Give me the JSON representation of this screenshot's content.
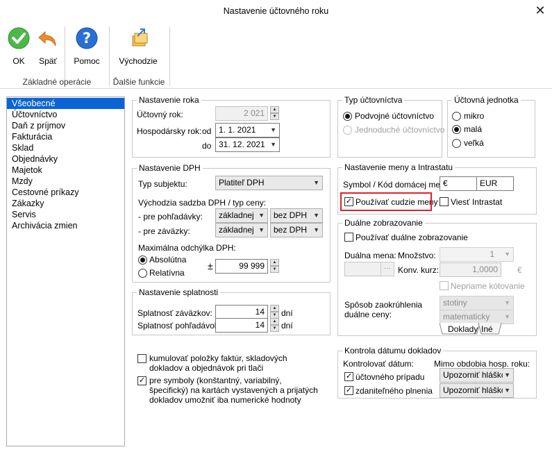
{
  "window": {
    "title": "Nastavenie účtovného roku",
    "close": "✕"
  },
  "ribbon": {
    "ok": "OK",
    "back": "Späť",
    "help": "Pomoc",
    "defaults": "Východzie",
    "group_basic": "Základné operácie",
    "group_more": "Ďalšie funkcie"
  },
  "nav": {
    "items": [
      "Všeobecné",
      "Účtovníctvo",
      "Daň z príjmov",
      "Fakturácia",
      "Sklad",
      "Objednávky",
      "Majetok",
      "Mzdy",
      "Cestovné príkazy",
      "Zákazky",
      "Servis",
      "Archivácia zmien"
    ],
    "selected": 0
  },
  "year": {
    "legend": "Nastavenie roka",
    "accounting_year_label": "Účtovný rok:",
    "accounting_year": "2 021",
    "fiscal_year_label": "Hospodársky rok:",
    "from_label": "od",
    "from": "1.   1. 2021",
    "to_label": "do",
    "to": "31. 12. 2021"
  },
  "accounting_type": {
    "legend": "Typ účtovníctva",
    "double": "Podvojné účtovníctvo",
    "single": "Jednoduché účtovníctvo"
  },
  "unit": {
    "legend": "Účtovná jednotka",
    "micro": "mikro",
    "small": "malá",
    "large": "veľká"
  },
  "vat": {
    "legend": "Nastavenie DPH",
    "subject_type_label": "Typ subjektu:",
    "subject_type": "Platiteľ DPH",
    "default_rate_label": "Východzia sadzba DPH / typ ceny:",
    "receivables_label": "- pre pohľadávky:",
    "receivables_rate": "základnej",
    "receivables_type": "bez DPH",
    "liabilities_label": "- pre záväzky:",
    "liabilities_rate": "základnej",
    "liabilities_type": "bez DPH",
    "max_diff_label": "Maximálna odchýlka DPH:",
    "absolute": "Absolútna",
    "relative": "Relatívna",
    "plusminus": "±",
    "max_diff": "99 999"
  },
  "currency": {
    "legend": "Nastavenie meny a Intrastatu",
    "symbol_label": "Symbol / Kód domácej meny:",
    "symbol": "€",
    "code": "EUR",
    "use_foreign": "Používať cudzie meny",
    "intrastat": "Viesť Intrastat"
  },
  "dual": {
    "legend": "Duálne zobrazovanie",
    "use_dual": "Používať duálne zobrazovanie",
    "dual_currency_label": "Duálna mena:",
    "quantity_label": "Množstvo:",
    "quantity": "1",
    "rate_label": "Konv. kurz:",
    "rate": "1,0000",
    "rate_unit": "€",
    "indirect": "Nepriame kótovanie",
    "rounding_label_1": "Spôsob zaokrúhlenia",
    "rounding_label_2": "duálne ceny:",
    "rounding_1": "stotiny",
    "rounding_2": "matematicky",
    "tab_docs": "Doklady",
    "tab_other": "Iné",
    "dots": "···"
  },
  "due": {
    "legend": "Nastavenie splatnosti",
    "liabilities_label": "Splatnosť záväzkov:",
    "liabilities": "14",
    "receivables_label": "Splatnosť pohľadávok:",
    "receivables": "14",
    "days": "dní"
  },
  "options": {
    "cumulate": "kumulovať položky faktúr, skladových dokladov a objednávok pri tlači",
    "symbols": "pre symboly (konštantný, variabilný, špecifický) na kartách vystavených a prijatých dokladov umožniť iba numerické hodnoty"
  },
  "datecheck": {
    "legend": "Kontrola dátumu dokladov",
    "check_label": "Kontrolovať dátum:",
    "outside_label": "Mimo obdobia hosp. roku:",
    "case_date": "účtovného prípadu",
    "tax_date": "zdaniteľného plnenia",
    "warn1": "Upozorniť hláškou",
    "warn2": "Upozorniť hláškou"
  }
}
